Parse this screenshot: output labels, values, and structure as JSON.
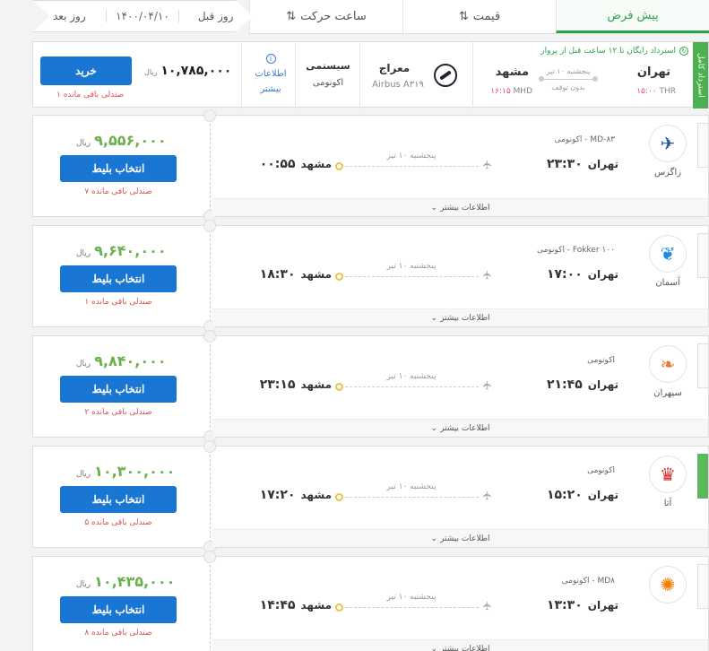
{
  "sort_tabs": [
    {
      "label": "پیش فرض",
      "active": true
    },
    {
      "label": "قیمت",
      "icon": "sort-price-icon"
    },
    {
      "label": "ساعت حرکت",
      "icon": "sort-time-icon"
    }
  ],
  "date_nav": {
    "prev": "روز قبل",
    "date": "۱۴۰۰/۰۴/۱۰",
    "next": "روز بعد"
  },
  "selected": {
    "refund_tag": "استرداد کامل",
    "refund_note": "استرداد رایگان تا ۱۲ ساعت قبل از پرواز",
    "origin_city": "تهران",
    "origin_code": "THR",
    "origin_time": "۱۵:۰۰",
    "route_date": "پنجشنبه ۱۰ تیر",
    "route_stop": "بدون توقف",
    "dest_city": "مشهد",
    "dest_code": "MHD",
    "dest_time": "۱۶:۱۵",
    "airline": "معراج",
    "aircraft": "Airbus A۳۱۹",
    "class_type": "سیستمی",
    "class_name": "اکونومی",
    "info_label": "اطلاعات بیشتر",
    "price": "۱۰,۷۸۵,۰۰۰",
    "currency": "ریال",
    "buy_label": "خرید",
    "seats": "۱ صندلی باقی مانده"
  },
  "flights": [
    {
      "airline": "زاگرس",
      "class_line": "MD-۸۳ - اکونومی",
      "dep_city": "تهران",
      "dep_time": "۲۳:۳۰",
      "route_date": "پنجشنبه ۱۰ تیر",
      "arr_city": "مشهد",
      "arr_time": "۰۰:۵۵",
      "price": "۹,۵۵۶,۰۰۰",
      "currency": "ریال",
      "button": "انتخاب بلیط",
      "seats": "۷ صندلی باقی مانده",
      "more": "اطلاعات بیشتر",
      "logo_color": "#2c5a9e",
      "logo_glyph": "✈"
    },
    {
      "airline": "آسمان",
      "class_line": "Fokker ۱۰۰ - اکونومی",
      "dep_city": "تهران",
      "dep_time": "۱۷:۰۰",
      "route_date": "پنجشنبه ۱۰ تیر",
      "arr_city": "مشهد",
      "arr_time": "۱۸:۳۰",
      "price": "۹,۶۴۰,۰۰۰",
      "currency": "ریال",
      "button": "انتخاب بلیط",
      "seats": "۱ صندلی باقی مانده",
      "more": "اطلاعات بیشتر",
      "logo_color": "#1e88e5",
      "logo_glyph": "❦"
    },
    {
      "airline": "سپهران",
      "class_line": "اکونومی",
      "dep_city": "تهران",
      "dep_time": "۲۱:۴۵",
      "route_date": "پنجشنبه ۱۰ تیر",
      "arr_city": "مشهد",
      "arr_time": "۲۳:۱۵",
      "price": "۹,۸۴۰,۰۰۰",
      "currency": "ریال",
      "button": "انتخاب بلیط",
      "seats": "۲ صندلی باقی مانده",
      "more": "اطلاعات بیشتر",
      "logo_color": "#e87a3c",
      "logo_glyph": "❧"
    },
    {
      "airline": "آتا",
      "class_line": "اکونومی",
      "dep_city": "تهران",
      "dep_time": "۱۵:۲۰",
      "route_date": "پنجشنبه ۱۰ تیر",
      "arr_city": "مشهد",
      "arr_time": "۱۷:۲۰",
      "price": "۱۰,۳۰۰,۰۰۰",
      "currency": "ریال",
      "button": "انتخاب بلیط",
      "seats": "۵ صندلی باقی مانده",
      "more": "اطلاعات بیشتر",
      "logo_color": "#d32f2f",
      "logo_glyph": "♛",
      "green_strip": true
    },
    {
      "airline": "",
      "class_line": "MD۸ - اکونومی",
      "dep_city": "تهران",
      "dep_time": "۱۳:۳۰",
      "route_date": "پنجشنبه ۱۰ تیر",
      "arr_city": "مشهد",
      "arr_time": "۱۴:۴۵",
      "price": "۱۰,۴۳۵,۰۰۰",
      "currency": "ریال",
      "button": "انتخاب بلیط",
      "seats": "۸ صندلی باقی مانده",
      "more": "اطلاعات بیشتر",
      "logo_color": "#f57c00",
      "logo_glyph": "✺"
    }
  ]
}
